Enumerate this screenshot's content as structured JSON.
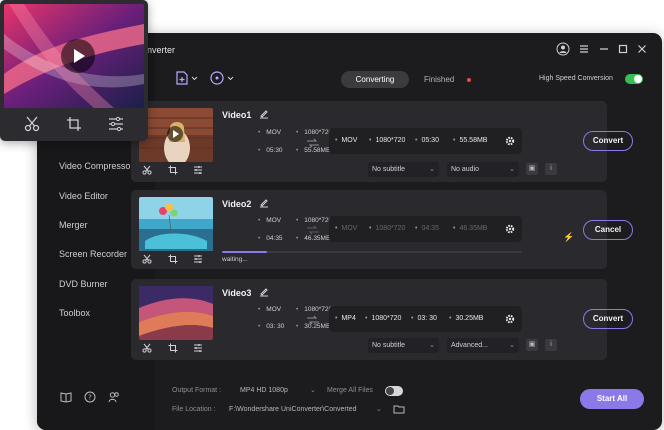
{
  "app": {
    "title_fragment": "onverter"
  },
  "sidebar": {
    "items": [
      {
        "label": "Video Compressor"
      },
      {
        "label": "Video Editor"
      },
      {
        "label": "Merger"
      },
      {
        "label": "Screen Recorder"
      },
      {
        "label": "DVD Burner"
      },
      {
        "label": "Toolbox"
      }
    ],
    "bottom_icons": [
      "book-icon",
      "help-icon",
      "users-icon"
    ]
  },
  "titlebar": {
    "icons": [
      "account-icon",
      "menu-icon",
      "minimize-icon",
      "maximize-icon",
      "close-icon"
    ]
  },
  "toolbar": {
    "add_file_icon": "add-file-icon",
    "add_disc_icon": "add-disc-icon",
    "tab_converting": "Converting",
    "tab_finished": "Finished",
    "high_speed_label": "High Speed Conversion",
    "high_speed_on": true
  },
  "videos": [
    {
      "title": "Video1",
      "src_format": "MOV",
      "src_res": "1080*720",
      "src_dur": "05:30",
      "src_size": "55.58MB",
      "out_format": "MOV",
      "out_res": "1080*720",
      "out_dur": "05:30",
      "out_size": "55.58MB",
      "subtitle": "No subtitle",
      "audio": "No audio",
      "action": "Convert"
    },
    {
      "title": "Video2",
      "src_format": "MOV",
      "src_res": "1080*720",
      "src_dur": "04:35",
      "src_size": "46.35MB",
      "out_format": "MOV",
      "out_res": "1080*720",
      "out_dur": "04:35",
      "out_size": "46.35MB",
      "status": "waiting...",
      "progress": 0.15,
      "action": "Cancel"
    },
    {
      "title": "Video3",
      "src_format": "MOV",
      "src_res": "1080*720",
      "src_dur": "03: 30",
      "src_size": "30.25MB",
      "out_format": "MP4",
      "out_res": "1080*720",
      "out_dur": "03: 30",
      "out_size": "30.25MB",
      "subtitle": "No subtitle",
      "audio": "Advanced...",
      "action": "Convert"
    }
  ],
  "footer": {
    "output_format_label": "Output Format :",
    "output_format_value": "MP4 HD 1080p",
    "merge_label": "Merge All Files",
    "merge_on": false,
    "file_location_label": "File Location :",
    "file_location_value": "F:\\Wondershare UniConverter\\Converted",
    "start_all": "Start All"
  },
  "colors": {
    "accent": "#8b79e8",
    "toggle_on": "#35c057",
    "dot": "#f24a3a",
    "bolt": "#f7b233"
  }
}
